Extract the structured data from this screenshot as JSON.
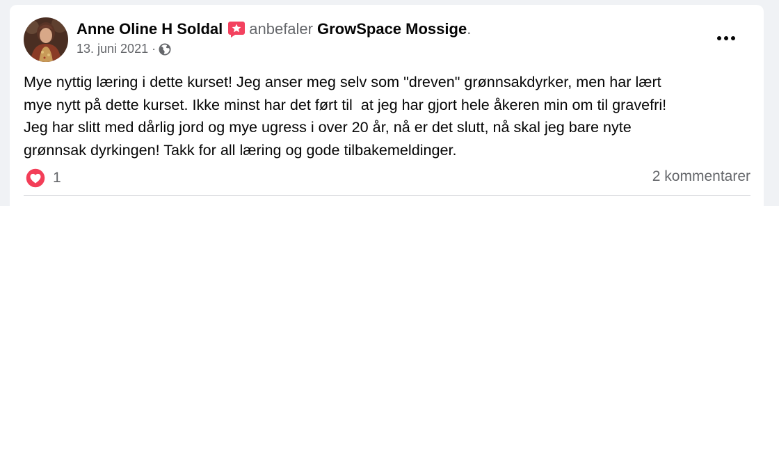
{
  "post": {
    "author": "Anne Oline H Soldal",
    "action": "anbefaler",
    "page": "GrowSpace Mossige",
    "period": ".",
    "date": "13. juni 2021",
    "separator": "·",
    "audience_icon": "globe-icon",
    "badge_icon": "recommendation-star-icon",
    "more_icon": "more-options-icon",
    "body": "Mye nyttig læring i dette kurset! Jeg anser meg selv som \"dreven\" grønnsakdyrker, men har lært\nmye nytt på dette kurset. Ikke minst har det ført til  at jeg har gjort hele åkeren min om til gravefri!\nJeg har slitt med dårlig jord og mye ugress i over 20 år, nå er det slutt, nå skal jeg bare nyte\ngrønnsak dyrkingen! Takk for all læring og gode tilbakemeldinger.",
    "reaction_icon": "love-reaction-icon",
    "reaction_count": "1",
    "comments": "2 kommentarer"
  },
  "colors": {
    "page_background": "#f0f2f5",
    "primary_text": "#050505",
    "secondary_text": "#65676b",
    "badge": "#f3425f",
    "love": "#f33e58",
    "divider": "#ced0d4"
  }
}
